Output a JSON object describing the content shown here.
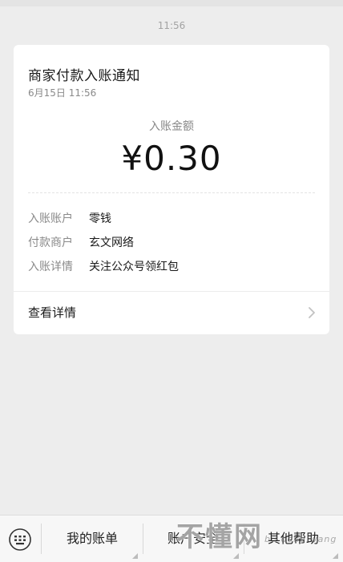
{
  "chat": {
    "time": "11:56"
  },
  "card": {
    "title": "商家付款入账通知",
    "date": "6月15日  11:56",
    "amount_label": "入账金额",
    "amount": "¥0.30",
    "details": [
      {
        "key": "入账账户",
        "value": "零钱"
      },
      {
        "key": "付款商户",
        "value": "玄文网络"
      },
      {
        "key": "入账详情",
        "value": "关注公众号领红包"
      }
    ],
    "view_details": "查看详情"
  },
  "bottom_menu": {
    "items": [
      {
        "label": "我的账单"
      },
      {
        "label": "账户安全"
      },
      {
        "label": "其他帮助"
      }
    ]
  },
  "watermark": {
    "main": "不懂网",
    "sub": "bu dong wang"
  },
  "icons": {
    "keyboard": "keyboard-icon",
    "chevron": "chevron-right-icon"
  }
}
